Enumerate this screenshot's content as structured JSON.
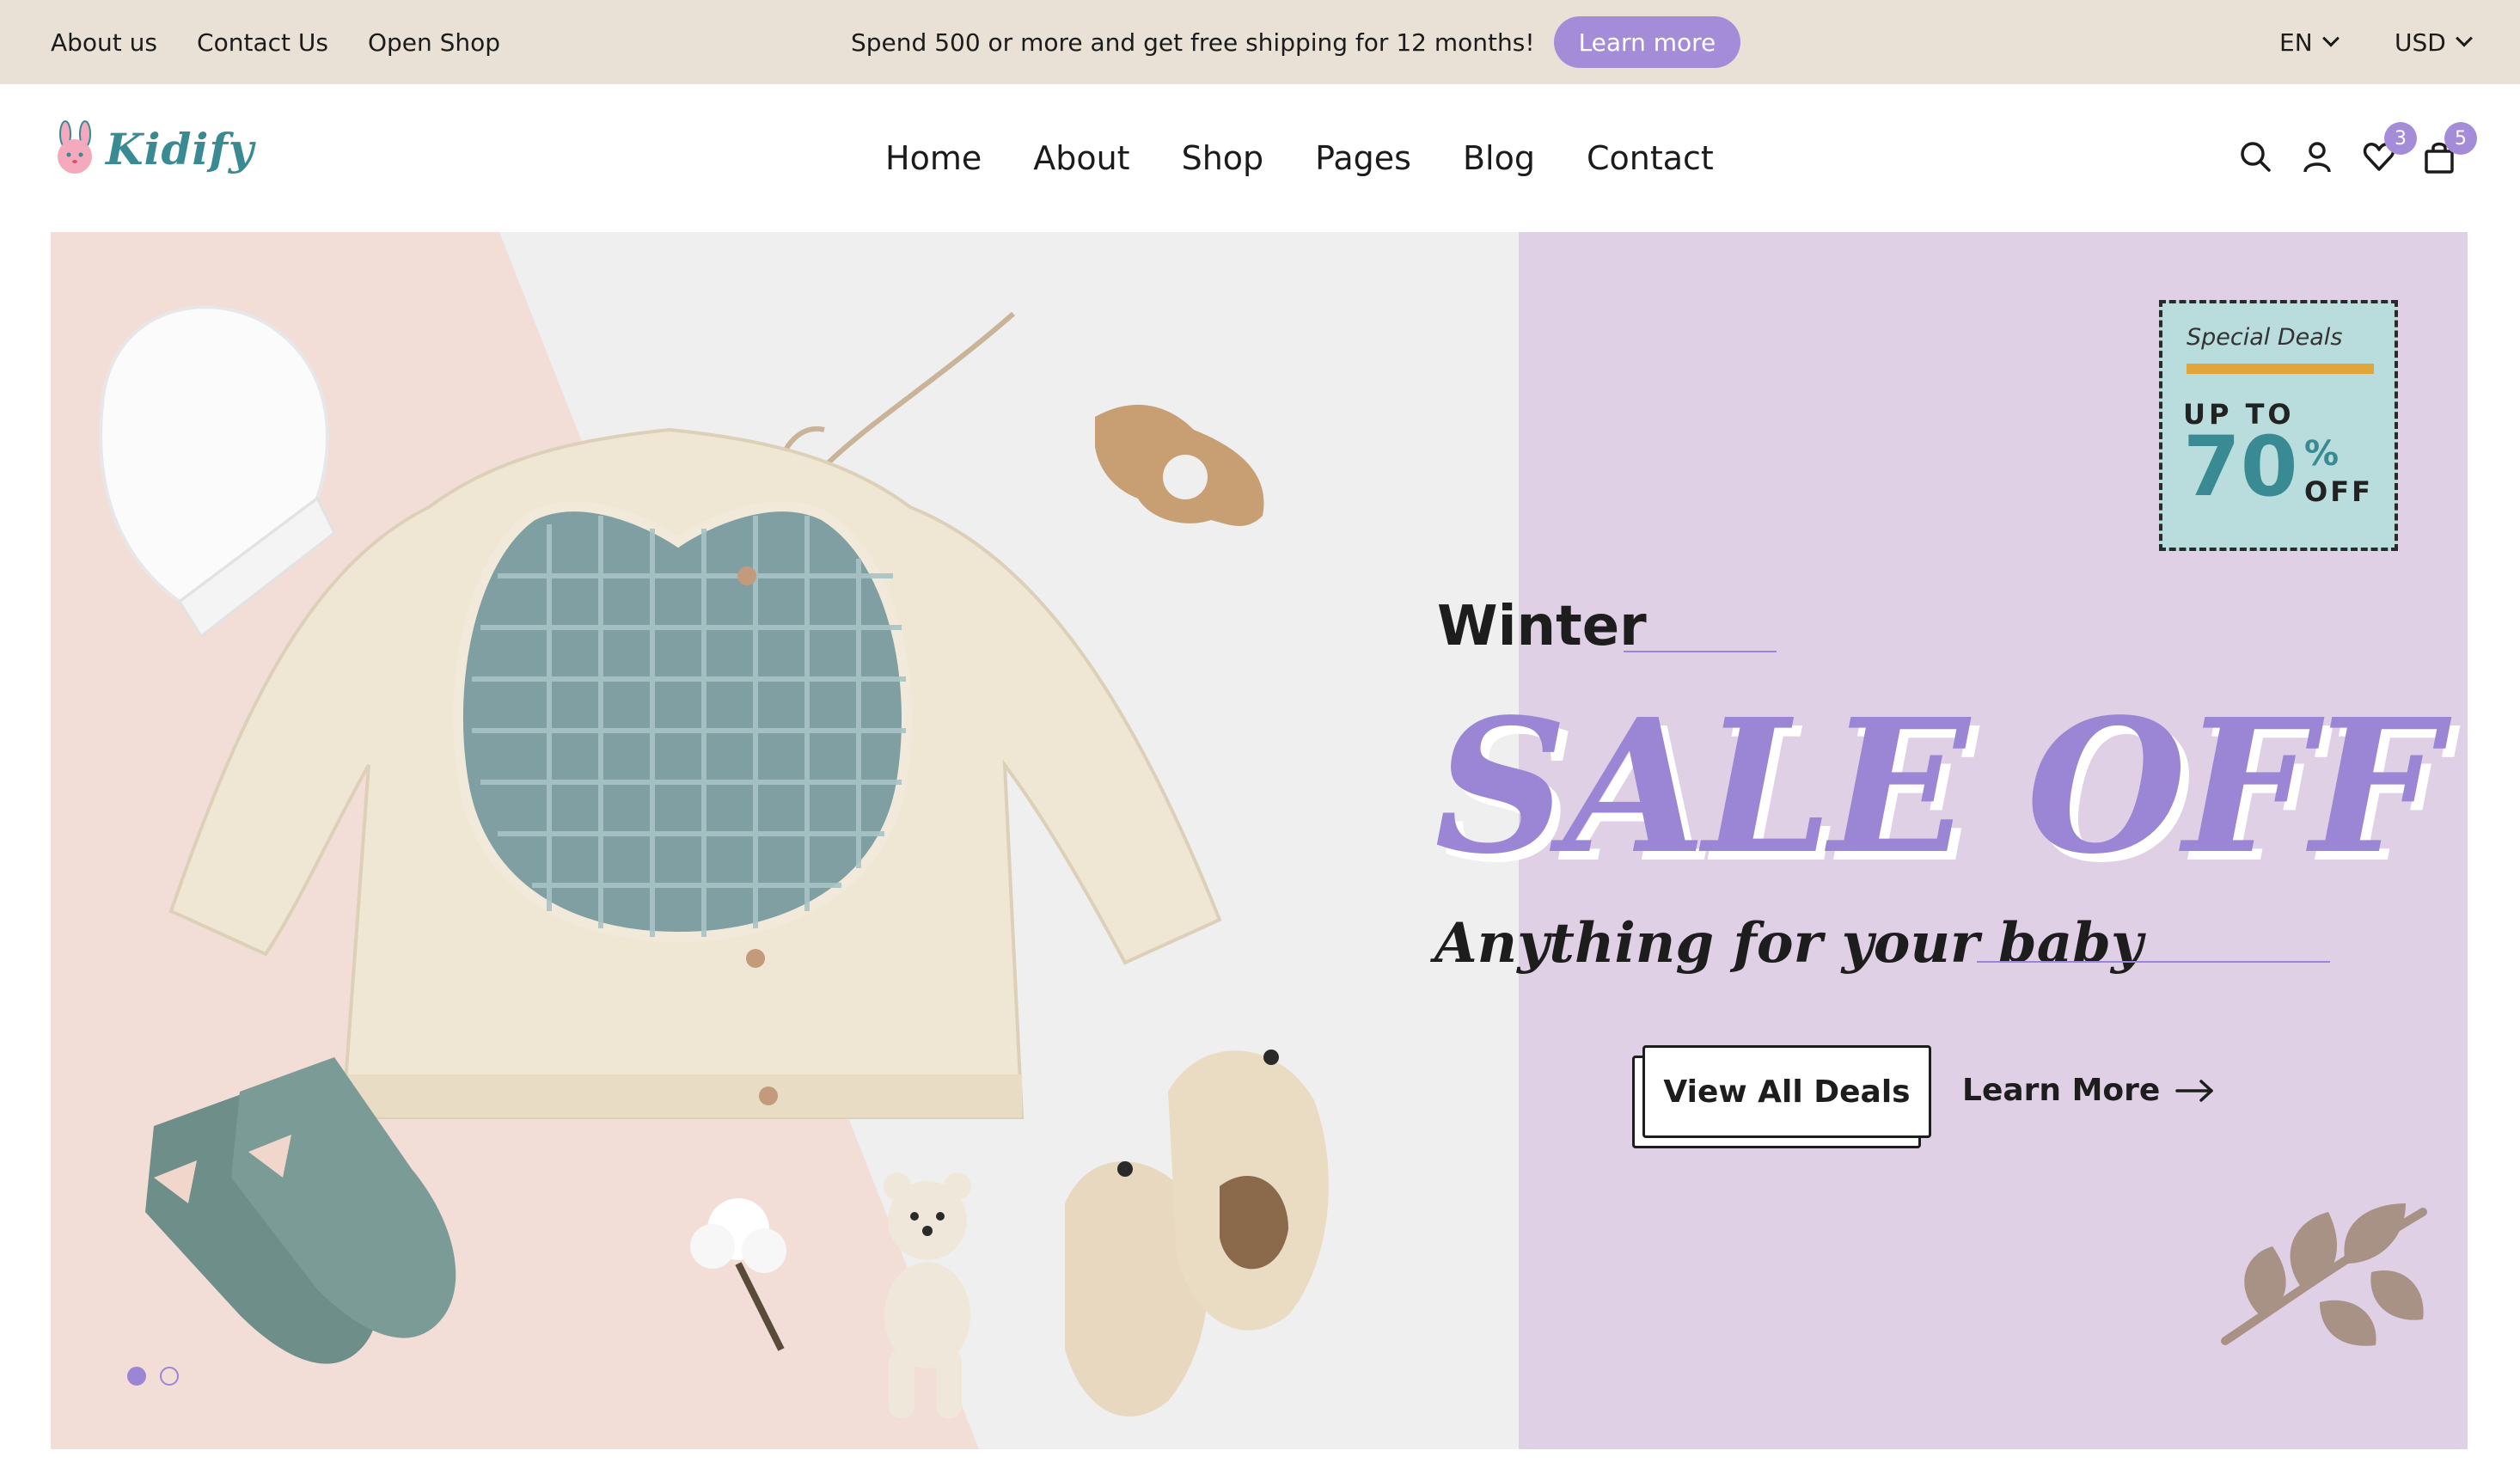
{
  "topbar": {
    "links": [
      "About us",
      "Contact Us",
      "Open Shop"
    ],
    "promo_text": "Spend 500 or more and get free shipping for 12 months!",
    "promo_button": "Learn more",
    "language": "EN",
    "currency": "USD"
  },
  "header": {
    "logo_text": "Kidify",
    "nav": [
      "Home",
      "About",
      "Shop",
      "Pages",
      "Blog",
      "Contact"
    ],
    "wishlist_count": "3",
    "cart_count": "5",
    "icons": [
      "search-icon",
      "user-icon",
      "heart-icon",
      "bag-icon"
    ]
  },
  "hero": {
    "kicker": "Winter",
    "headline": "SALE OFF",
    "tagline": "Anything for your baby",
    "primary_button": "View All Deals",
    "secondary_button": "Learn More",
    "slides": 2,
    "active_slide": 1,
    "badge": {
      "label": "Special Deals",
      "upto": "UP TO",
      "percent": "70",
      "percent_sign": "%",
      "off": "OFF"
    }
  },
  "colors": {
    "accent": "#a48cd9",
    "topbar_bg": "#e9e1d6",
    "hero_right_bg": "#dfd0e5",
    "hero_left_pink": "#f3ddd7",
    "teal": "#3a8a93"
  }
}
